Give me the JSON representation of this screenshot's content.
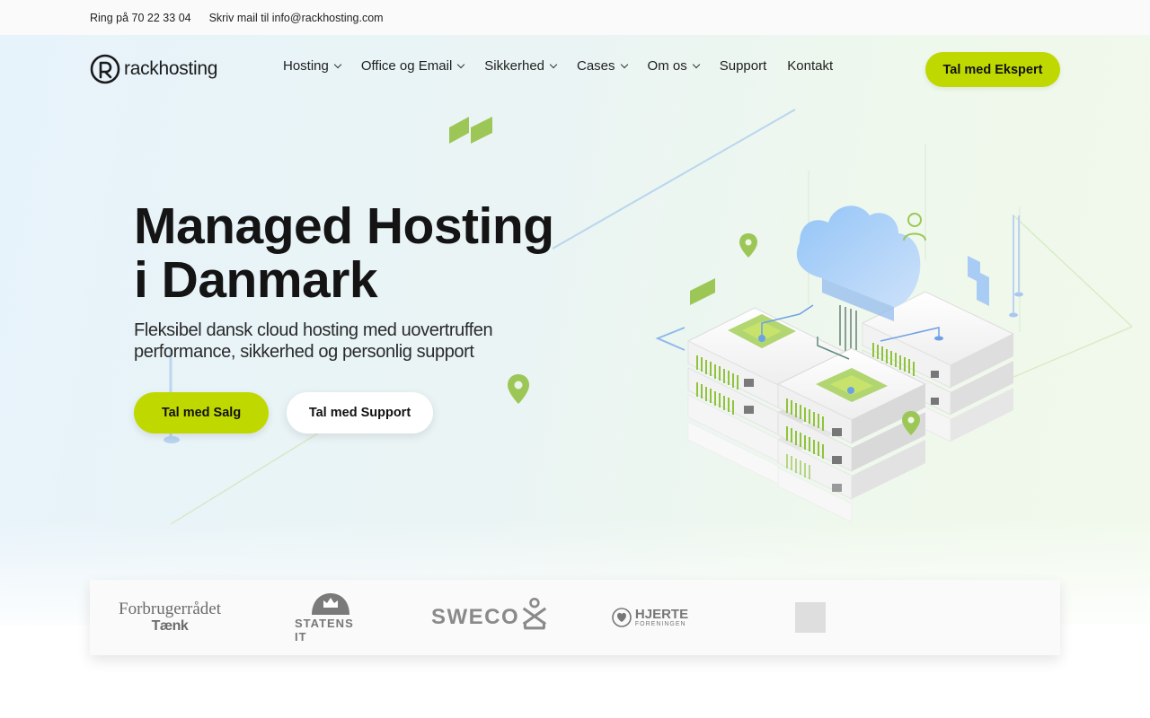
{
  "topbar": {
    "phone": "Ring på 70 22 33 04",
    "email": "Skriv mail til info@rackhosting.com"
  },
  "nav": {
    "logo_text": "rackhosting",
    "items": [
      {
        "label": "Hosting",
        "dropdown": true
      },
      {
        "label": "Office og Email",
        "dropdown": true
      },
      {
        "label": "Sikkerhed",
        "dropdown": true
      },
      {
        "label": "Cases",
        "dropdown": true
      },
      {
        "label": "Om os",
        "dropdown": true
      },
      {
        "label": "Support",
        "dropdown": false
      },
      {
        "label": "Kontakt",
        "dropdown": false
      }
    ],
    "cta": "Tal med Ekspert"
  },
  "hero": {
    "title_line1": "Managed Hosting",
    "title_line2": "i Danmark",
    "subtitle": "Fleksibel dansk cloud hosting med uovertruffen performance, sikkerhed og personlig support",
    "primary_button": "Tal med Salg",
    "secondary_button": "Tal med Support"
  },
  "clients": {
    "forbrugerraadet_l1": "Forbrugerrådet",
    "forbrugerraadet_l2": "Tænk",
    "statens": "STATENS IT",
    "sweco": "SWECO",
    "hjerte_l1": "HJERTE",
    "hjerte_l2": "FORENINGEN"
  },
  "colors": {
    "accent": "#bfd900",
    "text": "#141414",
    "hero_bg_left": "#e7f3fb",
    "hero_bg_right": "#f1f9ec"
  }
}
